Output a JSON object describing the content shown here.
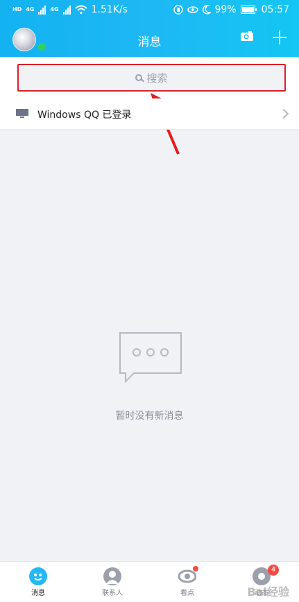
{
  "status_bar": {
    "net_left_1": "HD",
    "net_left_2": "HD",
    "sig_label_1": "4G",
    "sig_label_2": "4G",
    "speed": "1.51K/s",
    "battery": "99%",
    "time": "05:57"
  },
  "header": {
    "title": "消息"
  },
  "search": {
    "placeholder": "搜索"
  },
  "pc_login": {
    "label": "Windows QQ 已登录"
  },
  "empty_state": {
    "text": "暂时没有新消息"
  },
  "tabs": [
    {
      "label": "消息",
      "icon": "message-icon"
    },
    {
      "label": "联系人",
      "icon": "contacts-icon"
    },
    {
      "label": "看点",
      "icon": "watch-icon"
    },
    {
      "label": "动态",
      "icon": "moments-icon",
      "badge": "4"
    }
  ],
  "watermark": "Bai经验",
  "colors": {
    "header": "#1db5f3",
    "search_highlight": "#d9202b",
    "online": "#30d158"
  }
}
